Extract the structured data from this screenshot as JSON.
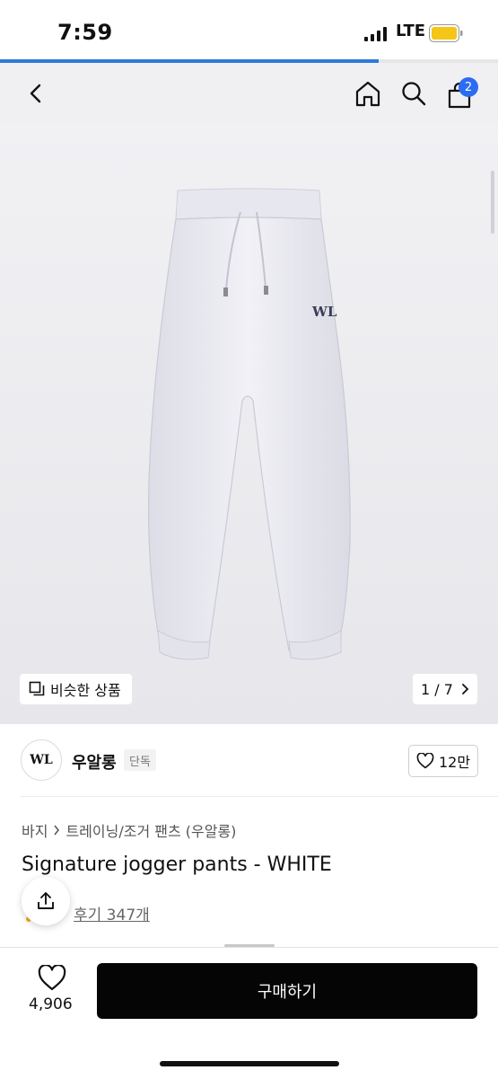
{
  "status_bar": {
    "time": "7:59",
    "network": "LTE"
  },
  "page_progress": 0.76,
  "nav": {
    "back_icon": "chevron-left-icon",
    "home_icon": "home-icon",
    "search_icon": "search-icon",
    "cart_icon": "bag-icon",
    "cart_count": "2"
  },
  "gallery": {
    "similar_label": "비슷한 상품",
    "counter": "1 / 7",
    "logo_text": "WL"
  },
  "brand": {
    "name": "우알롱",
    "tag": "단독",
    "logo_text": "WL",
    "likes": "12만"
  },
  "breadcrumb": {
    "parent": "바지",
    "child": "트레이닝/조거 팬츠 (우알롱)"
  },
  "product": {
    "title": "Signature jogger pants - WHITE"
  },
  "reviews": {
    "label": "후기 347개"
  },
  "bottom_bar": {
    "wish_count": "4,906",
    "buy_label": "구매하기"
  },
  "colors": {
    "accent": "#2b6cf0",
    "progress": "#2b7bd9",
    "buy_button": "#050505"
  }
}
